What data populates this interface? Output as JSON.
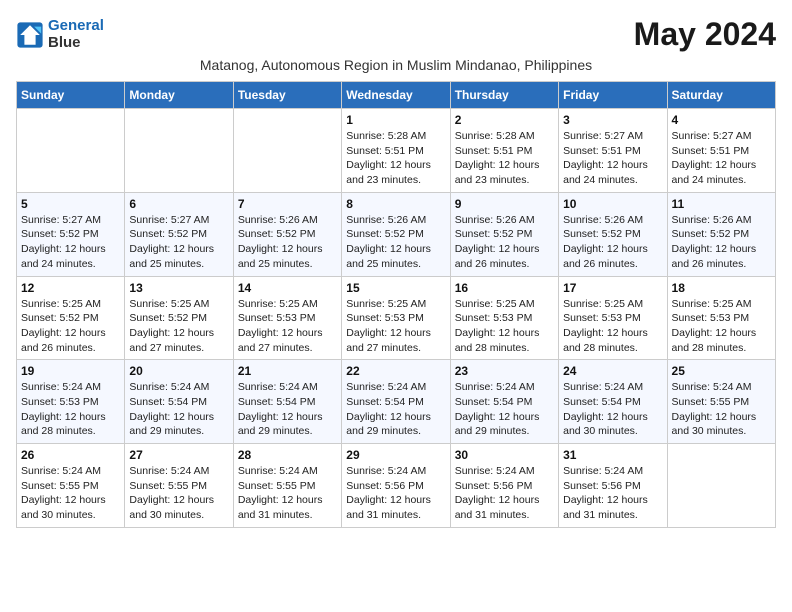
{
  "logo": {
    "line1": "General",
    "line2": "Blue"
  },
  "title": "May 2024",
  "subtitle": "Matanog, Autonomous Region in Muslim Mindanao, Philippines",
  "weekdays": [
    "Sunday",
    "Monday",
    "Tuesday",
    "Wednesday",
    "Thursday",
    "Friday",
    "Saturday"
  ],
  "weeks": [
    [
      {
        "day": "",
        "sunrise": "",
        "sunset": "",
        "daylight": ""
      },
      {
        "day": "",
        "sunrise": "",
        "sunset": "",
        "daylight": ""
      },
      {
        "day": "",
        "sunrise": "",
        "sunset": "",
        "daylight": ""
      },
      {
        "day": "1",
        "sunrise": "Sunrise: 5:28 AM",
        "sunset": "Sunset: 5:51 PM",
        "daylight": "Daylight: 12 hours and 23 minutes."
      },
      {
        "day": "2",
        "sunrise": "Sunrise: 5:28 AM",
        "sunset": "Sunset: 5:51 PM",
        "daylight": "Daylight: 12 hours and 23 minutes."
      },
      {
        "day": "3",
        "sunrise": "Sunrise: 5:27 AM",
        "sunset": "Sunset: 5:51 PM",
        "daylight": "Daylight: 12 hours and 24 minutes."
      },
      {
        "day": "4",
        "sunrise": "Sunrise: 5:27 AM",
        "sunset": "Sunset: 5:51 PM",
        "daylight": "Daylight: 12 hours and 24 minutes."
      }
    ],
    [
      {
        "day": "5",
        "sunrise": "Sunrise: 5:27 AM",
        "sunset": "Sunset: 5:52 PM",
        "daylight": "Daylight: 12 hours and 24 minutes."
      },
      {
        "day": "6",
        "sunrise": "Sunrise: 5:27 AM",
        "sunset": "Sunset: 5:52 PM",
        "daylight": "Daylight: 12 hours and 25 minutes."
      },
      {
        "day": "7",
        "sunrise": "Sunrise: 5:26 AM",
        "sunset": "Sunset: 5:52 PM",
        "daylight": "Daylight: 12 hours and 25 minutes."
      },
      {
        "day": "8",
        "sunrise": "Sunrise: 5:26 AM",
        "sunset": "Sunset: 5:52 PM",
        "daylight": "Daylight: 12 hours and 25 minutes."
      },
      {
        "day": "9",
        "sunrise": "Sunrise: 5:26 AM",
        "sunset": "Sunset: 5:52 PM",
        "daylight": "Daylight: 12 hours and 26 minutes."
      },
      {
        "day": "10",
        "sunrise": "Sunrise: 5:26 AM",
        "sunset": "Sunset: 5:52 PM",
        "daylight": "Daylight: 12 hours and 26 minutes."
      },
      {
        "day": "11",
        "sunrise": "Sunrise: 5:26 AM",
        "sunset": "Sunset: 5:52 PM",
        "daylight": "Daylight: 12 hours and 26 minutes."
      }
    ],
    [
      {
        "day": "12",
        "sunrise": "Sunrise: 5:25 AM",
        "sunset": "Sunset: 5:52 PM",
        "daylight": "Daylight: 12 hours and 26 minutes."
      },
      {
        "day": "13",
        "sunrise": "Sunrise: 5:25 AM",
        "sunset": "Sunset: 5:52 PM",
        "daylight": "Daylight: 12 hours and 27 minutes."
      },
      {
        "day": "14",
        "sunrise": "Sunrise: 5:25 AM",
        "sunset": "Sunset: 5:53 PM",
        "daylight": "Daylight: 12 hours and 27 minutes."
      },
      {
        "day": "15",
        "sunrise": "Sunrise: 5:25 AM",
        "sunset": "Sunset: 5:53 PM",
        "daylight": "Daylight: 12 hours and 27 minutes."
      },
      {
        "day": "16",
        "sunrise": "Sunrise: 5:25 AM",
        "sunset": "Sunset: 5:53 PM",
        "daylight": "Daylight: 12 hours and 28 minutes."
      },
      {
        "day": "17",
        "sunrise": "Sunrise: 5:25 AM",
        "sunset": "Sunset: 5:53 PM",
        "daylight": "Daylight: 12 hours and 28 minutes."
      },
      {
        "day": "18",
        "sunrise": "Sunrise: 5:25 AM",
        "sunset": "Sunset: 5:53 PM",
        "daylight": "Daylight: 12 hours and 28 minutes."
      }
    ],
    [
      {
        "day": "19",
        "sunrise": "Sunrise: 5:24 AM",
        "sunset": "Sunset: 5:53 PM",
        "daylight": "Daylight: 12 hours and 28 minutes."
      },
      {
        "day": "20",
        "sunrise": "Sunrise: 5:24 AM",
        "sunset": "Sunset: 5:54 PM",
        "daylight": "Daylight: 12 hours and 29 minutes."
      },
      {
        "day": "21",
        "sunrise": "Sunrise: 5:24 AM",
        "sunset": "Sunset: 5:54 PM",
        "daylight": "Daylight: 12 hours and 29 minutes."
      },
      {
        "day": "22",
        "sunrise": "Sunrise: 5:24 AM",
        "sunset": "Sunset: 5:54 PM",
        "daylight": "Daylight: 12 hours and 29 minutes."
      },
      {
        "day": "23",
        "sunrise": "Sunrise: 5:24 AM",
        "sunset": "Sunset: 5:54 PM",
        "daylight": "Daylight: 12 hours and 29 minutes."
      },
      {
        "day": "24",
        "sunrise": "Sunrise: 5:24 AM",
        "sunset": "Sunset: 5:54 PM",
        "daylight": "Daylight: 12 hours and 30 minutes."
      },
      {
        "day": "25",
        "sunrise": "Sunrise: 5:24 AM",
        "sunset": "Sunset: 5:55 PM",
        "daylight": "Daylight: 12 hours and 30 minutes."
      }
    ],
    [
      {
        "day": "26",
        "sunrise": "Sunrise: 5:24 AM",
        "sunset": "Sunset: 5:55 PM",
        "daylight": "Daylight: 12 hours and 30 minutes."
      },
      {
        "day": "27",
        "sunrise": "Sunrise: 5:24 AM",
        "sunset": "Sunset: 5:55 PM",
        "daylight": "Daylight: 12 hours and 30 minutes."
      },
      {
        "day": "28",
        "sunrise": "Sunrise: 5:24 AM",
        "sunset": "Sunset: 5:55 PM",
        "daylight": "Daylight: 12 hours and 31 minutes."
      },
      {
        "day": "29",
        "sunrise": "Sunrise: 5:24 AM",
        "sunset": "Sunset: 5:56 PM",
        "daylight": "Daylight: 12 hours and 31 minutes."
      },
      {
        "day": "30",
        "sunrise": "Sunrise: 5:24 AM",
        "sunset": "Sunset: 5:56 PM",
        "daylight": "Daylight: 12 hours and 31 minutes."
      },
      {
        "day": "31",
        "sunrise": "Sunrise: 5:24 AM",
        "sunset": "Sunset: 5:56 PM",
        "daylight": "Daylight: 12 hours and 31 minutes."
      },
      {
        "day": "",
        "sunrise": "",
        "sunset": "",
        "daylight": ""
      }
    ]
  ]
}
